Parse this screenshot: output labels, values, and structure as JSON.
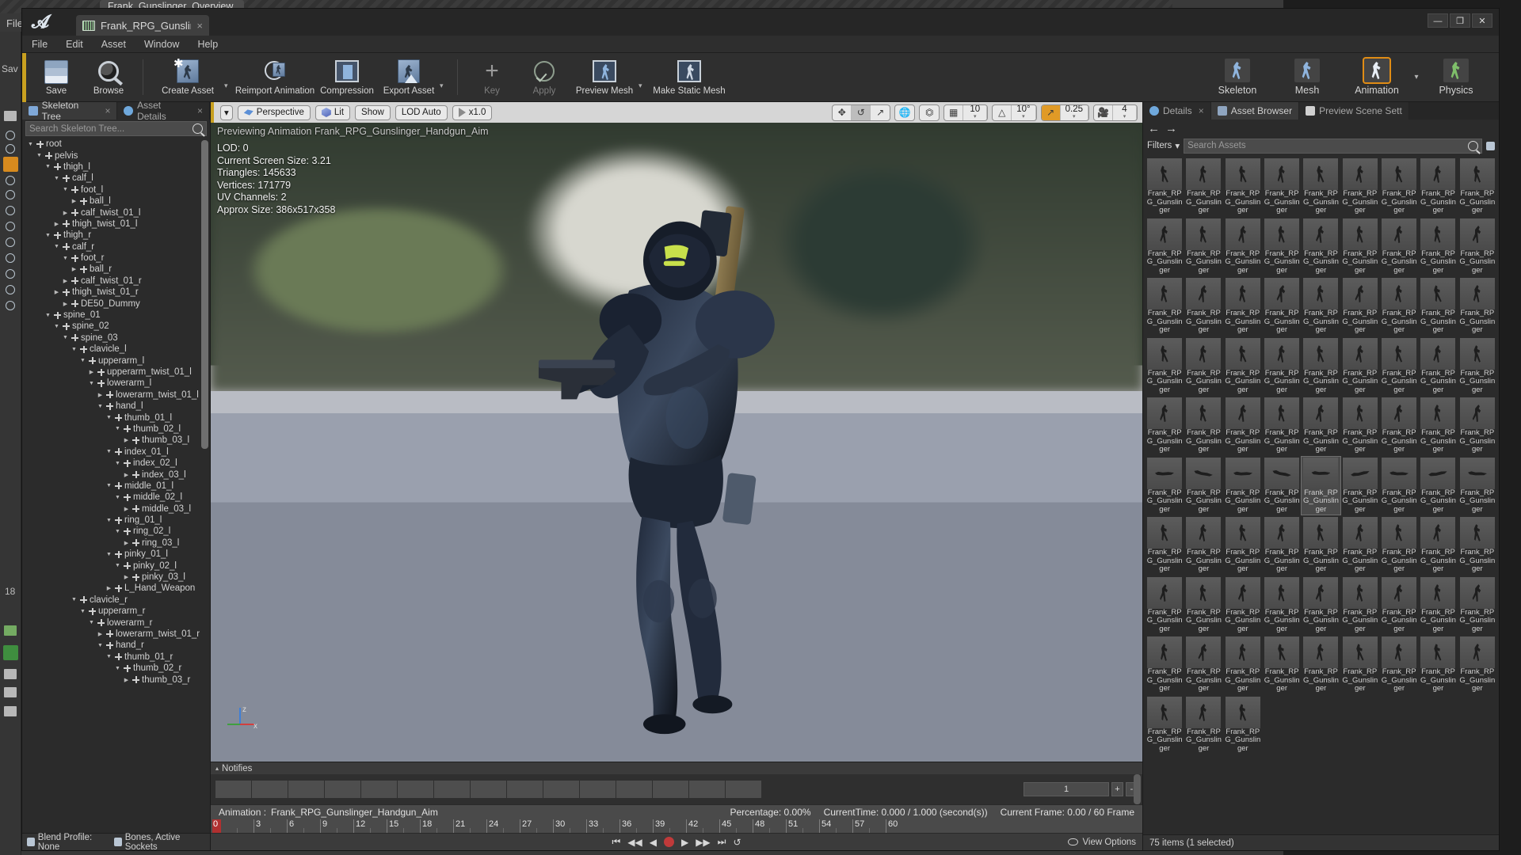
{
  "background_window": {
    "tab_title": "Frank_Gunslinger_Overview",
    "menu": "File",
    "save_label": "Sav",
    "frame_number": "18"
  },
  "window": {
    "tab_title": "Frank_RPG_Gunslinger_Ha",
    "tab_close": "×",
    "controls": {
      "minimize": "—",
      "maximize": "❐",
      "close": "✕"
    }
  },
  "menubar": {
    "items": [
      "File",
      "Edit",
      "Asset",
      "Window",
      "Help"
    ]
  },
  "toolbar": {
    "items": [
      {
        "label": "Save",
        "icon": "save-icon",
        "disabled": false,
        "caret": false
      },
      {
        "label": "Browse",
        "icon": "browse-icon",
        "disabled": false,
        "caret": false
      },
      {
        "label": "Create Asset",
        "icon": "create-asset-icon",
        "disabled": false,
        "caret": true
      },
      {
        "label": "Reimport Animation",
        "icon": "reimport-animation-icon",
        "disabled": false,
        "caret": false
      },
      {
        "label": "Compression",
        "icon": "compression-icon",
        "disabled": false,
        "caret": false
      },
      {
        "label": "Export Asset",
        "icon": "export-asset-icon",
        "disabled": false,
        "caret": true
      },
      {
        "label": "Key",
        "icon": "key-icon",
        "disabled": true,
        "caret": false
      },
      {
        "label": "Apply",
        "icon": "apply-icon",
        "disabled": true,
        "caret": false
      },
      {
        "label": "Preview Mesh",
        "icon": "preview-mesh-icon",
        "disabled": false,
        "caret": true
      },
      {
        "label": "Make Static Mesh",
        "icon": "make-static-mesh-icon",
        "disabled": false,
        "caret": false
      }
    ],
    "modes": [
      {
        "label": "Skeleton",
        "active": false
      },
      {
        "label": "Mesh",
        "active": false
      },
      {
        "label": "Animation",
        "active": true
      },
      {
        "label": "Physics",
        "active": false
      }
    ],
    "mode_caret": "▾"
  },
  "left_panel": {
    "tabs": [
      {
        "label": "Skeleton Tree",
        "icon": "skeleton-tree-icon",
        "active": true,
        "close": "×"
      },
      {
        "label": "Asset Details",
        "icon": "asset-details-icon",
        "active": false,
        "close": "×"
      }
    ],
    "search_placeholder": "Search Skeleton Tree...",
    "search_value": "",
    "tree": [
      {
        "depth": 0,
        "label": "root",
        "expanded": true
      },
      {
        "depth": 1,
        "label": "pelvis",
        "expanded": true
      },
      {
        "depth": 2,
        "label": "thigh_l",
        "expanded": true
      },
      {
        "depth": 3,
        "label": "calf_l",
        "expanded": true
      },
      {
        "depth": 4,
        "label": "foot_l",
        "expanded": true
      },
      {
        "depth": 5,
        "label": "ball_l",
        "expanded": false
      },
      {
        "depth": 4,
        "label": "calf_twist_01_l",
        "expanded": false
      },
      {
        "depth": 3,
        "label": "thigh_twist_01_l",
        "expanded": false
      },
      {
        "depth": 2,
        "label": "thigh_r",
        "expanded": true
      },
      {
        "depth": 3,
        "label": "calf_r",
        "expanded": true
      },
      {
        "depth": 4,
        "label": "foot_r",
        "expanded": true
      },
      {
        "depth": 5,
        "label": "ball_r",
        "expanded": false
      },
      {
        "depth": 4,
        "label": "calf_twist_01_r",
        "expanded": false
      },
      {
        "depth": 3,
        "label": "thigh_twist_01_r",
        "expanded": false
      },
      {
        "depth": 4,
        "label": "DE50_Dummy",
        "expanded": false
      },
      {
        "depth": 2,
        "label": "spine_01",
        "expanded": true
      },
      {
        "depth": 3,
        "label": "spine_02",
        "expanded": true
      },
      {
        "depth": 4,
        "label": "spine_03",
        "expanded": true
      },
      {
        "depth": 5,
        "label": "clavicle_l",
        "expanded": true
      },
      {
        "depth": 6,
        "label": "upperarm_l",
        "expanded": true
      },
      {
        "depth": 7,
        "label": "upperarm_twist_01_l",
        "expanded": false
      },
      {
        "depth": 7,
        "label": "lowerarm_l",
        "expanded": true
      },
      {
        "depth": 8,
        "label": "lowerarm_twist_01_l",
        "expanded": false
      },
      {
        "depth": 8,
        "label": "hand_l",
        "expanded": true
      },
      {
        "depth": 9,
        "label": "thumb_01_l",
        "expanded": true
      },
      {
        "depth": 10,
        "label": "thumb_02_l",
        "expanded": true
      },
      {
        "depth": 11,
        "label": "thumb_03_l",
        "expanded": false
      },
      {
        "depth": 9,
        "label": "index_01_l",
        "expanded": true
      },
      {
        "depth": 10,
        "label": "index_02_l",
        "expanded": true
      },
      {
        "depth": 11,
        "label": "index_03_l",
        "expanded": false
      },
      {
        "depth": 9,
        "label": "middle_01_l",
        "expanded": true
      },
      {
        "depth": 10,
        "label": "middle_02_l",
        "expanded": true
      },
      {
        "depth": 11,
        "label": "middle_03_l",
        "expanded": false
      },
      {
        "depth": 9,
        "label": "ring_01_l",
        "expanded": true
      },
      {
        "depth": 10,
        "label": "ring_02_l",
        "expanded": true
      },
      {
        "depth": 11,
        "label": "ring_03_l",
        "expanded": false
      },
      {
        "depth": 9,
        "label": "pinky_01_l",
        "expanded": true
      },
      {
        "depth": 10,
        "label": "pinky_02_l",
        "expanded": true
      },
      {
        "depth": 11,
        "label": "pinky_03_l",
        "expanded": false
      },
      {
        "depth": 9,
        "label": "L_Hand_Weapon",
        "expanded": false
      },
      {
        "depth": 5,
        "label": "clavicle_r",
        "expanded": true
      },
      {
        "depth": 6,
        "label": "upperarm_r",
        "expanded": true
      },
      {
        "depth": 7,
        "label": "lowerarm_r",
        "expanded": true
      },
      {
        "depth": 8,
        "label": "lowerarm_twist_01_r",
        "expanded": false
      },
      {
        "depth": 8,
        "label": "hand_r",
        "expanded": true
      },
      {
        "depth": 9,
        "label": "thumb_01_r",
        "expanded": true
      },
      {
        "depth": 10,
        "label": "thumb_02_r",
        "expanded": true
      },
      {
        "depth": 11,
        "label": "thumb_03_r",
        "expanded": false
      }
    ],
    "footer": {
      "blend_profile": "Blend Profile: None",
      "bones_sockets": "Bones, Active Sockets"
    }
  },
  "viewport": {
    "toolbar": {
      "menu_caret": "▾",
      "perspective": "Perspective",
      "lit": "Lit",
      "show": "Show",
      "lod": "LOD Auto",
      "playrate": "x1.0"
    },
    "gizmos": {
      "translate": "move-gizmo",
      "rotate": "rotate-gizmo",
      "scale": "scale-gizmo",
      "world_coord": "globe-icon",
      "surface_snap": "surface-snap-icon",
      "grid_snap_icon": "grid-icon",
      "grid_snap_value": "10",
      "angle_snap_icon": "angle-icon",
      "angle_snap_value": "10°",
      "scale_snap_icon": "scale-snap-icon",
      "scale_snap_value": "0.25",
      "camera_speed_icon": "camera-icon",
      "camera_speed_value": "4",
      "caret": "▾"
    },
    "overlay_title": "Previewing Animation Frank_RPG_Gunslinger_Handgun_Aim",
    "stats": [
      "LOD: 0",
      "Current Screen Size: 3.21",
      "Triangles: 145633",
      "Vertices: 171779",
      "UV Channels: 2",
      "Approx Size: 386x517x358"
    ],
    "axis": {
      "z": "z",
      "x": "x"
    }
  },
  "timeline": {
    "notifies_label": "Notifies",
    "notifies_caret": "▴",
    "frame_input": "1",
    "plus": "+",
    "minus": "-",
    "anim_label": "Animation :",
    "anim_name": "Frank_RPG_Gunslinger_Handgun_Aim",
    "percentage_label": "Percentage:",
    "percentage_value": "0.00%",
    "currenttime_label": "CurrentTime:",
    "currenttime_value": "0.000 / 1.000 (second(s))",
    "currentframe_label": "Current Frame:",
    "currentframe_value": "0.00 / 60 Frame",
    "ruler_ticks": [
      "0",
      "3",
      "6",
      "9",
      "12",
      "15",
      "18",
      "21",
      "24",
      "27",
      "30",
      "33",
      "36",
      "39",
      "42",
      "45",
      "48",
      "51",
      "54",
      "57",
      "60"
    ],
    "playhead_value": "0",
    "transport": {
      "to_start": "⏮",
      "step_back": "◀◀",
      "play_back": "◀",
      "record": "record-button",
      "play": "▶",
      "step_forward": "▶▶",
      "to_end": "⏭",
      "loop": "↺"
    },
    "view_options": "View Options"
  },
  "right_panel": {
    "tabs": [
      {
        "label": "Details",
        "icon": "details-icon",
        "active": false,
        "close": "×"
      },
      {
        "label": "Asset Browser",
        "icon": "asset-browser-icon",
        "active": true,
        "close": ""
      },
      {
        "label": "Preview Scene Sett",
        "icon": "preview-scene-icon",
        "active": false,
        "close": ""
      }
    ],
    "nav_back": "←",
    "nav_forward": "→",
    "filters_label": "Filters",
    "filters_caret": "▾",
    "search_placeholder": "Search Assets",
    "search_value": "",
    "search_icon": "search-icon",
    "settings_icon": "settings-icon",
    "asset_name": "Frank_RPG_Gunslinger",
    "asset_rows": 9,
    "asset_cols": 9,
    "selected_index": 49,
    "last_row_count": 3,
    "prone_rows": [
      5
    ],
    "status": "75 items (1 selected)"
  }
}
